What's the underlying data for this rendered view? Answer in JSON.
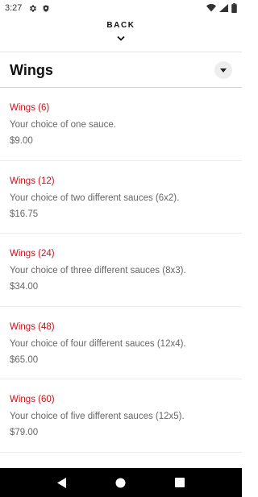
{
  "status_bar": {
    "time": "3:27",
    "left_icons": [
      "gear-icon",
      "shield-icon"
    ],
    "right_icons": [
      "wifi-icon",
      "signal-icon",
      "battery-icon"
    ]
  },
  "header": {
    "back_label": "BACK"
  },
  "section": {
    "title": "Wings"
  },
  "menu_items": [
    {
      "name": "Wings (6)",
      "description": "Your choice of one sauce.",
      "price": "$9.00"
    },
    {
      "name": "Wings (12)",
      "description": "Your choice of two different sauces (6x2).",
      "price": "$16.75"
    },
    {
      "name": "Wings (24)",
      "description": "Your choice of three different sauces (8x3).",
      "price": "$34.00"
    },
    {
      "name": "Wings (48)",
      "description": "Your choice of four different sauces (12x4).",
      "price": "$65.00"
    },
    {
      "name": "Wings (60)",
      "description": "Your choice of five different sauces (12x5).",
      "price": "$79.00"
    }
  ],
  "colors": {
    "item_name": "#c0141c",
    "text_secondary": "#666666",
    "nav_bar": "#000000"
  },
  "nav_bar": {
    "icons": [
      "back-triangle-icon",
      "home-circle-icon",
      "recents-square-icon"
    ]
  }
}
